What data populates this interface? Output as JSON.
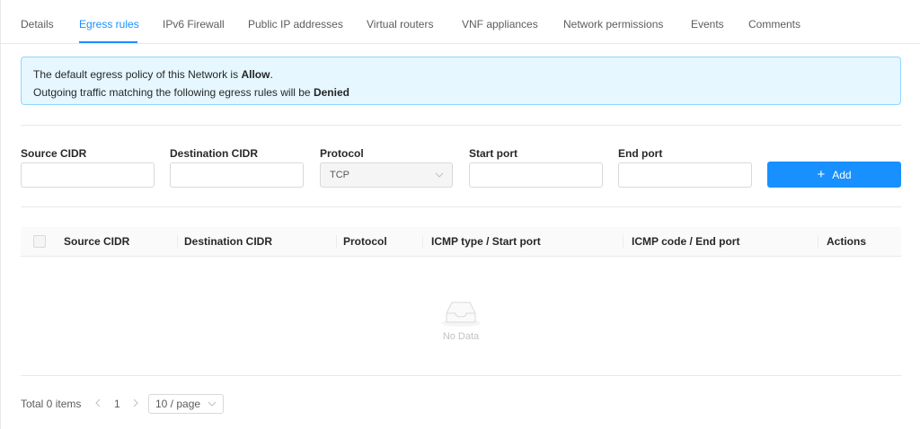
{
  "tabs": [
    {
      "label": "Details",
      "active": false
    },
    {
      "label": "Egress rules",
      "active": true
    },
    {
      "label": "IPv6 Firewall",
      "active": false
    },
    {
      "label": "Public IP addresses",
      "active": false
    },
    {
      "label": "Virtual routers",
      "active": false
    },
    {
      "label": "VNF appliances",
      "active": false
    },
    {
      "label": "Network permissions",
      "active": false
    },
    {
      "label": "Events",
      "active": false
    },
    {
      "label": "Comments",
      "active": false
    }
  ],
  "alert": {
    "line1_prefix": "The default egress policy of this Network is ",
    "line1_value": "Allow",
    "line1_suffix": ".",
    "line2_prefix": "Outgoing traffic matching the following egress rules will be ",
    "line2_value": "Denied"
  },
  "form": {
    "source_cidr_label": "Source CIDR",
    "source_cidr_value": "",
    "destination_cidr_label": "Destination CIDR",
    "destination_cidr_value": "",
    "protocol_label": "Protocol",
    "protocol_value": "TCP",
    "start_port_label": "Start port",
    "start_port_value": "",
    "end_port_label": "End port",
    "end_port_value": "",
    "add_label": "Add"
  },
  "table": {
    "columns": [
      "Source CIDR",
      "Destination CIDR",
      "Protocol",
      "ICMP type / Start port",
      "ICMP code / End port",
      "Actions"
    ],
    "rows": [],
    "empty_text": "No Data"
  },
  "pagination": {
    "total_text": "Total 0 items",
    "current_page": "1",
    "page_size": "10 / page"
  },
  "colors": {
    "accent": "#1890ff",
    "alert_bg": "#e6f7ff",
    "alert_border": "#91d5ff"
  }
}
